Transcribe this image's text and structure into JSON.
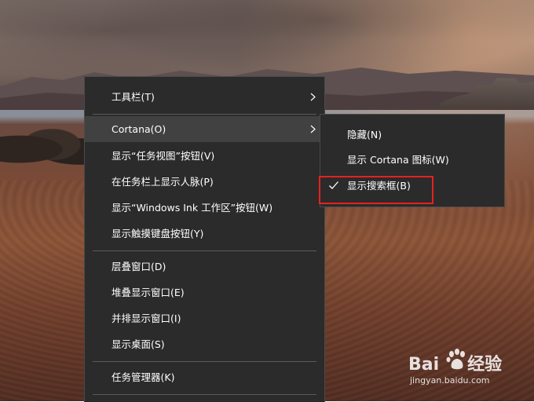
{
  "context_menu": {
    "items": [
      {
        "label": "工具栏(T)",
        "has_submenu": true
      },
      {
        "label": "Cortana(O)",
        "has_submenu": true,
        "active": true
      },
      {
        "label": "显示“任务视图”按钮(V)"
      },
      {
        "label": "在任务栏上显示人脉(P)"
      },
      {
        "label": "显示“Windows Ink 工作区”按钮(W)"
      },
      {
        "label": "显示触摸键盘按钮(Y)"
      },
      {
        "label": "层叠窗口(D)"
      },
      {
        "label": "堆叠显示窗口(E)"
      },
      {
        "label": "并排显示窗口(I)"
      },
      {
        "label": "显示桌面(S)"
      },
      {
        "label": "任务管理器(K)"
      }
    ]
  },
  "cortana_submenu": {
    "items": [
      {
        "label": "隐藏(N)",
        "checked": false
      },
      {
        "label": "显示 Cortana 图标(W)",
        "checked": false
      },
      {
        "label": "显示搜索框(B)",
        "checked": true
      }
    ]
  },
  "watermark": {
    "brand_left": "Bai",
    "brand_right": "经验",
    "url": "jingyan.baidu.com"
  },
  "colors": {
    "menu_bg": "#2b2b2b",
    "hover_bg": "#414141",
    "highlight": "#e5221f"
  }
}
